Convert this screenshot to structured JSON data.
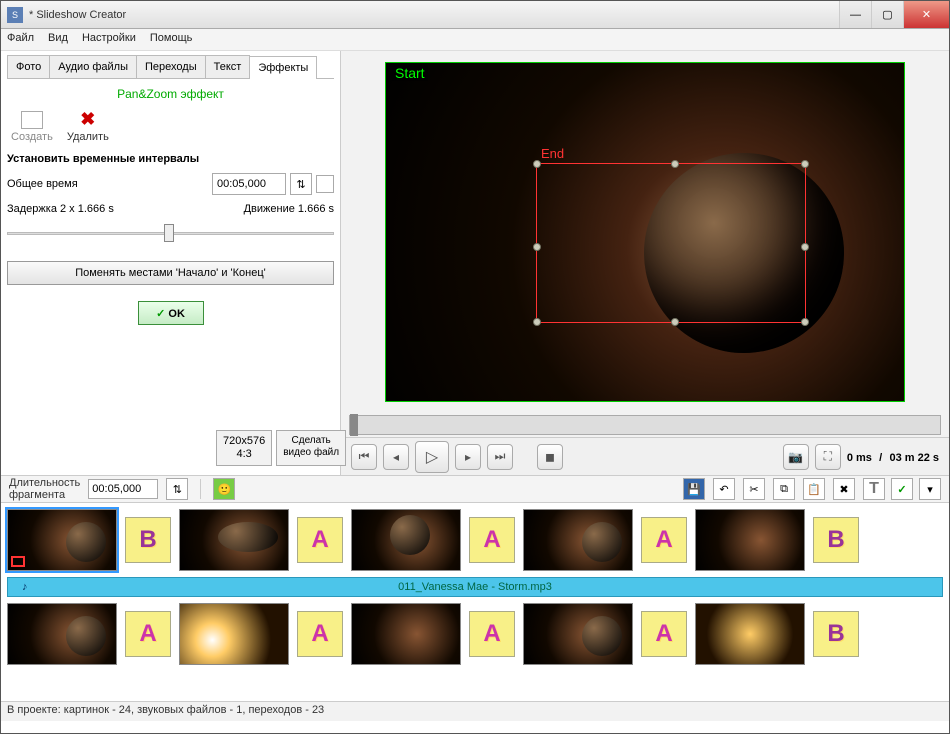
{
  "window": {
    "title": "* Slideshow Creator"
  },
  "menu": {
    "file": "Файл",
    "view": "Вид",
    "settings": "Настройки",
    "help": "Помощь"
  },
  "tabs": {
    "photo": "Фото",
    "audio": "Аудио файлы",
    "transitions": "Переходы",
    "text": "Текст",
    "effects": "Эффекты"
  },
  "panel": {
    "title": "Pan&Zoom эффект",
    "create": "Создать",
    "delete": "Удалить",
    "section": "Установить временные интервалы",
    "total_label": "Общее время",
    "total_value": "00:05,000",
    "delay_label": "Задержка 2 x 1.666 s",
    "motion_label": "Движение 1.666 s",
    "swap": "Поменять местами 'Начало' и 'Конец'",
    "ok": "OK"
  },
  "leftbottom": {
    "res": "720x576",
    "ratio": "4:3",
    "make": "Сделать\nвидео файл"
  },
  "preview": {
    "start": "Start",
    "end": "End"
  },
  "playbar": {
    "pos": "0 ms",
    "sep": "/",
    "dur": "03 m 22 s"
  },
  "timeline_toolbar": {
    "dur_label": "Длительность\nфрагмента",
    "dur_value": "00:05,000"
  },
  "audio": {
    "file": "011_Vanessa Mae - Storm.mp3"
  },
  "transitions": [
    "B",
    "A",
    "A",
    "A",
    "B",
    "A",
    "A",
    "A",
    "A",
    "B"
  ],
  "status": "В проекте: картинок - 24, звуковых файлов - 1, переходов - 23"
}
